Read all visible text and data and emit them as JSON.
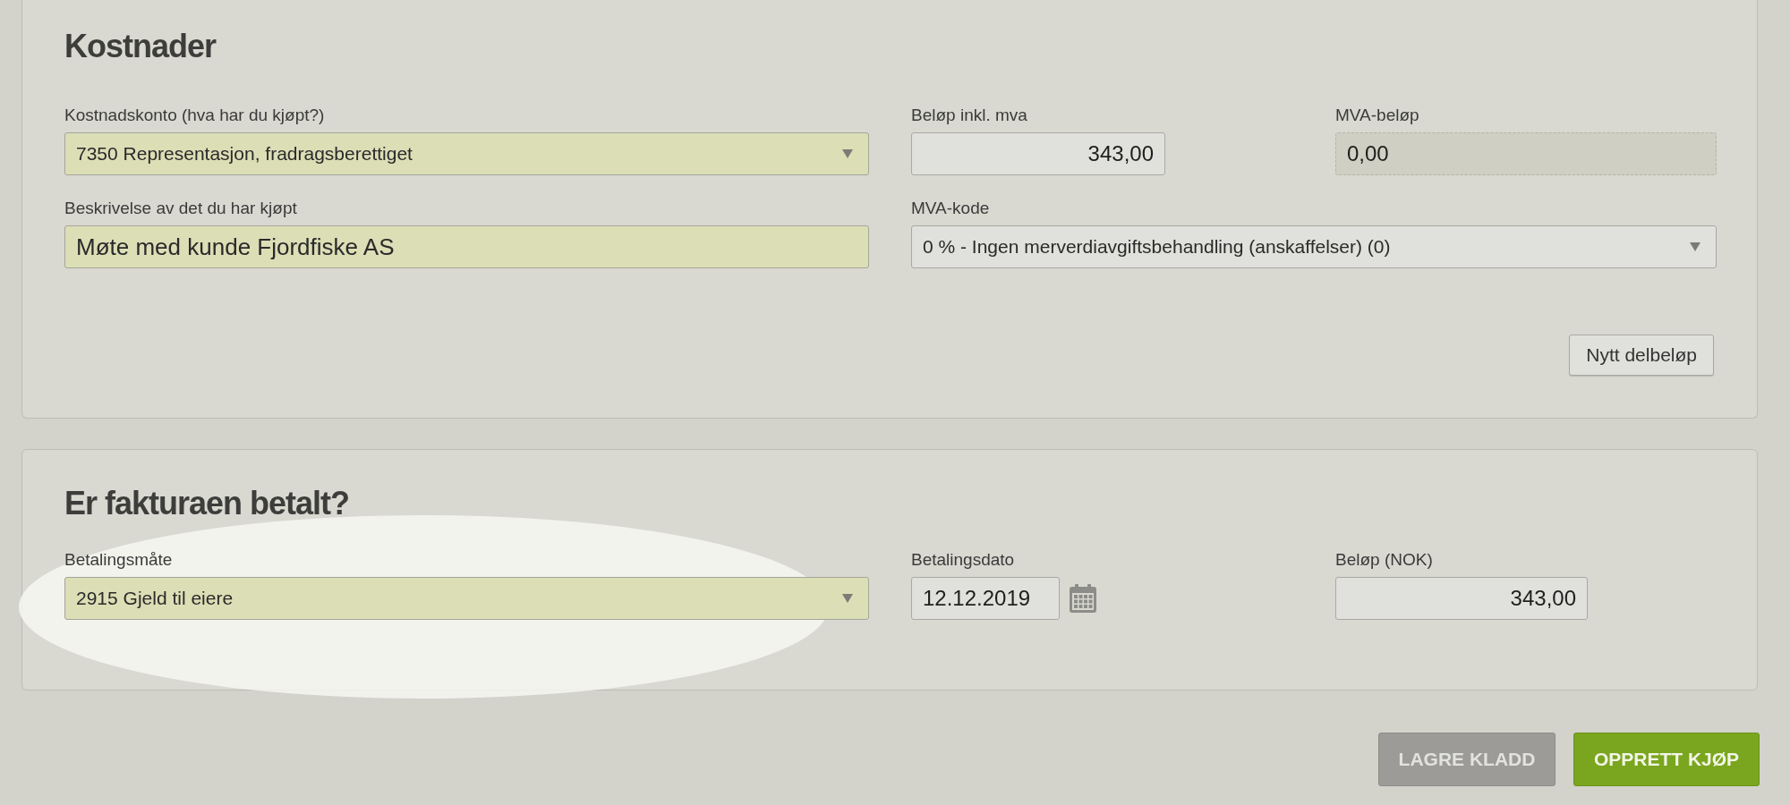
{
  "costs": {
    "title": "Kostnader",
    "fields": [
      {
        "kind": "select",
        "label": "Kostnadskonto (hva har du kjøpt?)",
        "value": "7350 Representasjon, fradragsberettiget",
        "highlighted": true
      },
      {
        "kind": "number",
        "label": "Beløp inkl. mva",
        "value": "343,00",
        "highlighted": false
      },
      {
        "kind": "readonly",
        "label": "MVA-beløp",
        "value": "0,00",
        "highlighted": false
      },
      {
        "kind": "text",
        "label": "Beskrivelse av det du har kjøpt",
        "value": "Møte med kunde Fjordfiske AS",
        "highlighted": true
      },
      {
        "kind": "select",
        "label": "MVA-kode",
        "value": "0 % - Ingen merverdiavgiftsbehandling (anskaffelser) (0)",
        "highlighted": false
      }
    ],
    "add_button": "Nytt delbeløp"
  },
  "payment": {
    "title": "Er fakturaen betalt?",
    "fields": [
      {
        "kind": "select",
        "label": "Betalingsmåte",
        "value": "2915 Gjeld til eiere",
        "highlighted": true
      },
      {
        "kind": "date",
        "label": "Betalingsdato",
        "value": "12.12.2019",
        "highlighted": false
      },
      {
        "kind": "number",
        "label": "Beløp (NOK)",
        "value": "343,00",
        "highlighted": false
      }
    ]
  },
  "actions": [
    {
      "label": "LAGRE KLADD",
      "disabled": true
    },
    {
      "label": "OPPRETT KJØP",
      "disabled": false
    }
  ]
}
